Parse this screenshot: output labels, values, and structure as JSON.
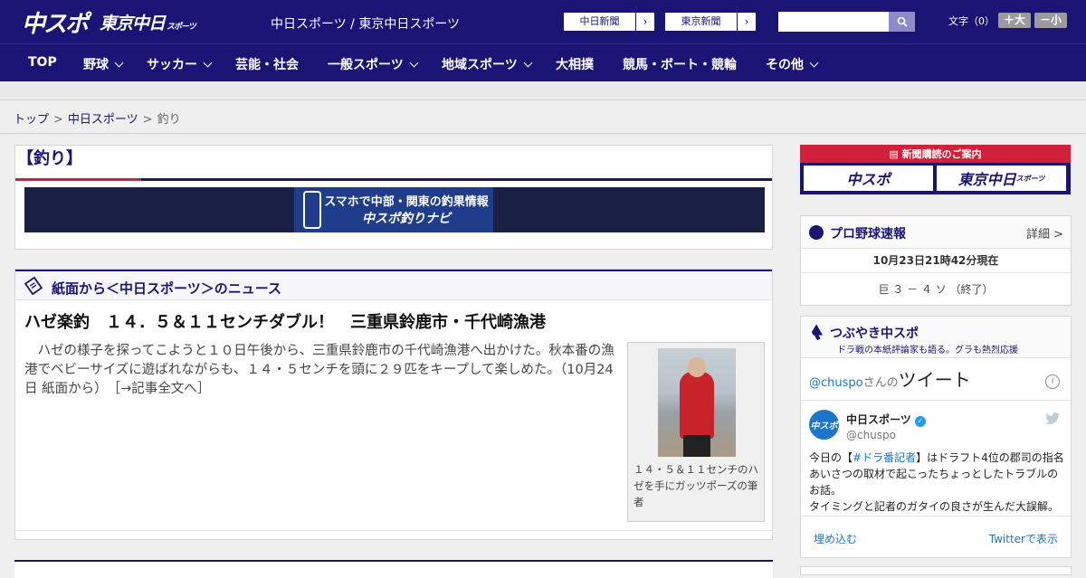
{
  "header": {
    "logo_main": "中スポ",
    "logo_tokyo": "東京中日",
    "logo_tokyo_small": "スポーツ",
    "site_name": "中日スポーツ / 東京中日スポーツ",
    "ext_links": [
      {
        "label": "中日新聞"
      },
      {
        "label": "東京新聞"
      }
    ],
    "search_placeholder": "",
    "font_label": "文字（0）",
    "font_bigger": "＋大",
    "font_smaller": "－小",
    "colors": {
      "brand": "#1a1575",
      "accent": "#d0203a"
    }
  },
  "nav": {
    "items": [
      {
        "label": "TOP",
        "dropdown": false
      },
      {
        "label": "野球",
        "dropdown": true
      },
      {
        "label": "サッカー",
        "dropdown": true
      },
      {
        "label": "芸能・社会",
        "dropdown": false
      },
      {
        "label": "一般スポーツ",
        "dropdown": true
      },
      {
        "label": "地域スポーツ",
        "dropdown": true
      },
      {
        "label": "大相撲",
        "dropdown": false
      },
      {
        "label": "競馬・ボート・競輪",
        "dropdown": false
      },
      {
        "label": "その他",
        "dropdown": true
      }
    ]
  },
  "breadcrumb": {
    "items": [
      "トップ",
      "中日スポーツ",
      "釣り"
    ],
    "separator": ">"
  },
  "category": {
    "title": "【釣り】",
    "banner_line1": "スマホで中部・関東の釣果情報",
    "banner_line2": "中スポ釣りナビ"
  },
  "news": {
    "section_title": "紙面から＜中日スポーツ＞のニュース",
    "headline": "ハゼ楽釣　１４．５＆１１センチダブル！　三重県鈴鹿市・千代崎漁港",
    "body": "　ハゼの様子を探ってこようと１０日午後から、三重県鈴鹿市の千代崎漁港へ出かけた。秋本番の漁港でベビーサイズに遊ばれながらも、１４・５センチを頭に２９匹をキープして楽しめた。（10月24日 紙面から）",
    "read_more": "［→記事全文へ］",
    "photo_caption": "１４・５＆１１センチのハゼを手にガッツポーズの筆者"
  },
  "sidebar": {
    "subscription_title": "新聞購読のご案内",
    "sub_buttons": [
      "中スポ",
      "東京中日"
    ],
    "sub_button_small": "スポーツ",
    "baseball": {
      "title": "プロ野球速報",
      "detail": "詳細 >",
      "timestamp": "10月23日21時42分現在",
      "score": "巨 ３ － ４ ソ （終了）"
    },
    "twitter": {
      "title": "つぶやき中スポ",
      "subtitle": "ドラ戦の本紙評論家も語る。グラも熱烈応援",
      "user": "@chuspo",
      "suffix": "さんの",
      "tweet_word": "ツイート",
      "account_name": "中日スポーツ",
      "handle": "@chuspo",
      "avatar_text": "中スポ",
      "tweet_pre": "今日の【",
      "tweet_tag": "#ドラ番記者",
      "tweet_post": "】はドラフト4位の郡司の指名あいさつの取材で起こったちょっとしたトラブルのお話。",
      "tweet_more": "タイミングと記者のガタイの良さが生んだ大誤解。",
      "embed": "埋め込む",
      "view": "Twitterで表示"
    }
  }
}
